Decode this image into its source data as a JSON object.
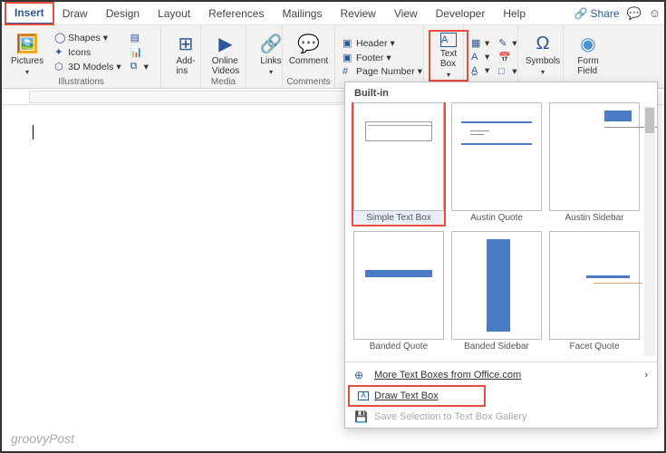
{
  "tabs": [
    "Insert",
    "Draw",
    "Design",
    "Layout",
    "References",
    "Mailings",
    "Review",
    "View",
    "Developer",
    "Help"
  ],
  "share": "Share",
  "ribbon": {
    "pictures": "Pictures",
    "shapes": "Shapes",
    "icons": "Icons",
    "models3d": "3D Models",
    "illustrations_label": "Illustrations",
    "addins": "Add-\nins",
    "onlinevideos": "Online\nVideos",
    "media_label": "Media",
    "links": "Links",
    "comment": "Comment",
    "comments_label": "Comments",
    "header": "Header",
    "footer": "Footer",
    "pagenumber": "Page Number",
    "textbox": "Text\nBox",
    "symbols": "Symbols",
    "formfield": "Form\nField"
  },
  "dropdown": {
    "builtin": "Built-in",
    "items": [
      {
        "label": "Simple Text Box"
      },
      {
        "label": "Austin Quote"
      },
      {
        "label": "Austin Sidebar"
      },
      {
        "label": "Banded Quote"
      },
      {
        "label": "Banded Sidebar"
      },
      {
        "label": "Facet Quote"
      }
    ],
    "more": "More Text Boxes from Office.com",
    "draw": "Draw Text Box",
    "save": "Save Selection to Text Box Gallery"
  },
  "watermark": "groovyPost"
}
